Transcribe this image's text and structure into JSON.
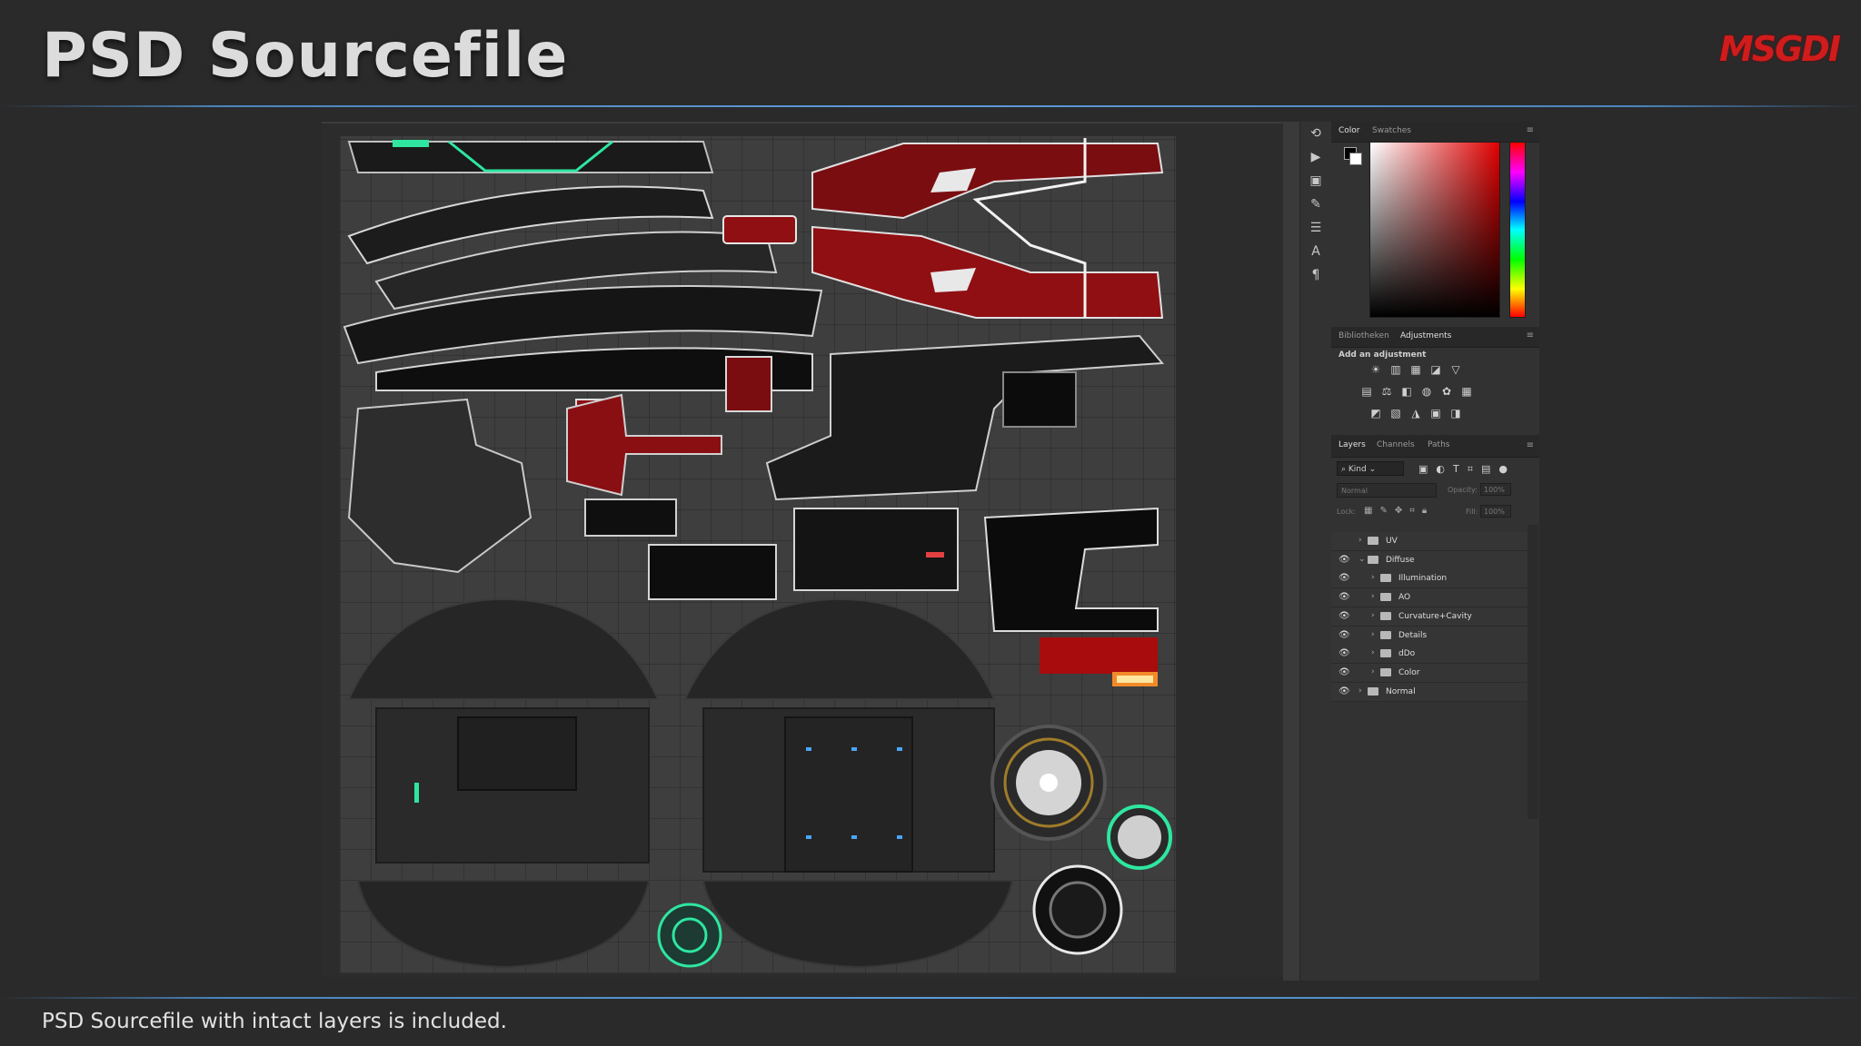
{
  "slide": {
    "title": "PSD Sourcefile",
    "logo": "MSGDI",
    "caption": "PSD Sourcefile with intact layers is included."
  },
  "photoshop": {
    "color_panel": {
      "tabs": [
        "Color",
        "Swatches"
      ],
      "foreground": "#000000",
      "background": "#ffffff",
      "picked_hue": "#e00000"
    },
    "adjustments_panel": {
      "tabs": [
        "Bibliotheken",
        "Adjustments"
      ],
      "active_tab": "Adjustments",
      "heading": "Add an adjustment"
    },
    "layers_panel": {
      "tabs": [
        "Layers",
        "Channels",
        "Paths"
      ],
      "active_tab": "Layers",
      "filter_kind": "Kind",
      "blend_mode": "Normal",
      "opacity_label": "Opacity:",
      "opacity_value": "100%",
      "lock_label": "Lock:",
      "fill_label": "Fill:",
      "fill_value": "100%",
      "layers": [
        {
          "name": "UV",
          "visible": false,
          "indent": 0,
          "expanded": false
        },
        {
          "name": "Diffuse",
          "visible": true,
          "indent": 0,
          "expanded": true
        },
        {
          "name": "Illumination",
          "visible": true,
          "indent": 1,
          "expanded": false
        },
        {
          "name": "AO",
          "visible": true,
          "indent": 1,
          "expanded": false
        },
        {
          "name": "Curvature+Cavity",
          "visible": true,
          "indent": 1,
          "expanded": false
        },
        {
          "name": "Details",
          "visible": true,
          "indent": 1,
          "expanded": false
        },
        {
          "name": "dDo",
          "visible": true,
          "indent": 1,
          "expanded": false
        },
        {
          "name": "Color",
          "visible": true,
          "indent": 1,
          "expanded": false
        },
        {
          "name": "Normal",
          "visible": true,
          "indent": 0,
          "expanded": false
        }
      ]
    }
  },
  "colors": {
    "accent_rule": "#5c9bd6",
    "logo_red": "#d01c1c",
    "texture_red": "#8f0f12",
    "glow_green": "#2ee6a0",
    "glow_blue": "#4aa6ff"
  }
}
